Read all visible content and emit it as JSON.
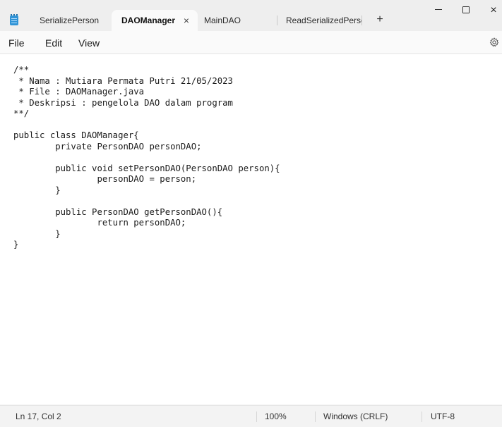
{
  "tabs": [
    {
      "label": "SerializePerson"
    },
    {
      "label": "DAOManager",
      "close": "×"
    },
    {
      "label": "MainDAO"
    },
    {
      "label": "ReadSerializedPerso"
    }
  ],
  "new_tab_symbol": "+",
  "window_controls": {
    "close": "×"
  },
  "menu": {
    "file": "File",
    "edit": "Edit",
    "view": "View"
  },
  "editor": {
    "lines": [
      "/**",
      " * Nama : Mutiara Permata Putri 21/05/2023",
      " * File : DAOManager.java",
      " * Deskripsi : pengelola DAO dalam program",
      "**/",
      "",
      "public class DAOManager{",
      "        private PersonDAO personDAO;",
      "",
      "        public void setPersonDAO(PersonDAO person){",
      "                personDAO = person;",
      "        }",
      "",
      "        public PersonDAO getPersonDAO(){",
      "                return personDAO;",
      "        }",
      "}"
    ]
  },
  "status": {
    "position": "Ln 17, Col 2",
    "zoom": "100%",
    "line_ending": "Windows (CRLF)",
    "encoding": "UTF-8"
  },
  "colors": {
    "accent_icon": "#2f93d6",
    "editor_bg": "#ffffff",
    "chrome_bg": "#f3f3f3"
  }
}
